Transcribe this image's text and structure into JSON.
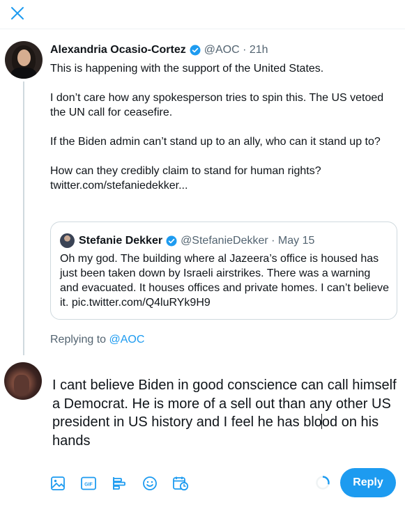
{
  "header": {
    "close_icon": "close-icon"
  },
  "tweet": {
    "author_name": "Alexandria Ocasio-Cortez",
    "handle": "@AOC",
    "separator": " · ",
    "time": "21h",
    "lines": [
      "This is happening with the support of the United States.",
      "",
      "I don’t care how any spokesperson tries to spin this. The US vetoed the UN call for ceasefire.",
      "",
      "If the Biden admin can’t stand up to an ally, who can it stand up to?",
      "",
      "How can they credibly claim to stand for human rights?",
      "twitter.com/stefaniedekker..."
    ]
  },
  "quote": {
    "author_name": "Stefanie Dekker",
    "handle": "@StefanieDekker",
    "separator": " · ",
    "date": "May 15",
    "text": "Oh my god. The building where al Jazeera’s office is housed has just been taken down by Israeli airstrikes. There was a warning and evacuated. It houses offices and private homes. I can’t believe it. pic.twitter.com/Q4luRYk9H9"
  },
  "replying": {
    "prefix": "Replying to ",
    "mention": "@AOC"
  },
  "compose": {
    "text_before_caret": "I cant believe Biden in good conscience can call himself a Democrat. He is more of a sell out than any other US president in US history and I feel he has blo",
    "text_after_caret": "od on his hands"
  },
  "toolbar": {
    "icons": [
      "image-icon",
      "gif-icon",
      "poll-icon",
      "emoji-icon",
      "schedule-icon"
    ],
    "gif_label": "GIF",
    "reply_label": "Reply"
  },
  "colors": {
    "accent": "#1d9bf0",
    "text": "#0f1419",
    "muted": "#536471",
    "border": "#cfd9de"
  }
}
